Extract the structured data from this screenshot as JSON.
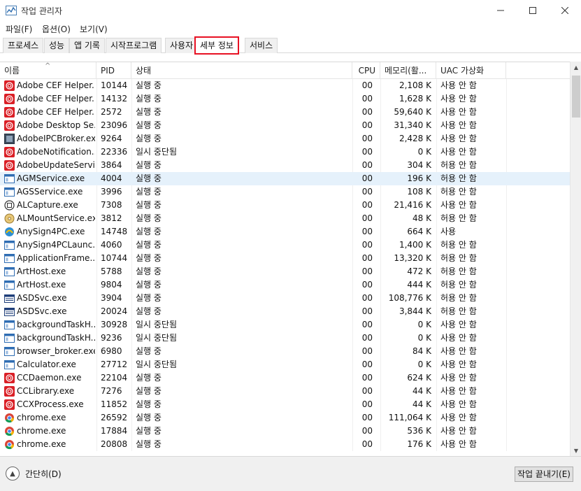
{
  "window": {
    "title": "작업 관리자"
  },
  "menu": [
    "파일(F)",
    "옵션(O)",
    "보기(V)"
  ],
  "tabs": [
    "프로세스",
    "성능",
    "앱 기록",
    "시작프로그램",
    "사용자",
    "세부 정보",
    "서비스"
  ],
  "active_tab": "세부 정보",
  "columns": [
    "이름",
    "PID",
    "상태",
    "CPU",
    "메모리(활...",
    "UAC 가상화"
  ],
  "rows": [
    {
      "icon": "adobe-icon",
      "name": "Adobe CEF Helper....",
      "pid": "10144",
      "status": "실행 중",
      "cpu": "00",
      "mem": "2,108 K",
      "uac": "사용 안 함"
    },
    {
      "icon": "adobe-icon",
      "name": "Adobe CEF Helper....",
      "pid": "14132",
      "status": "실행 중",
      "cpu": "00",
      "mem": "1,628 K",
      "uac": "사용 안 함"
    },
    {
      "icon": "adobe-icon",
      "name": "Adobe CEF Helper....",
      "pid": "2572",
      "status": "실행 중",
      "cpu": "00",
      "mem": "59,640 K",
      "uac": "사용 안 함"
    },
    {
      "icon": "adobe-icon",
      "name": "Adobe Desktop Se...",
      "pid": "23096",
      "status": "실행 중",
      "cpu": "00",
      "mem": "31,340 K",
      "uac": "사용 안 함"
    },
    {
      "icon": "app-dark-icon",
      "name": "AdobeIPCBroker.exe",
      "pid": "9264",
      "status": "실행 중",
      "cpu": "00",
      "mem": "2,428 K",
      "uac": "사용 안 함"
    },
    {
      "icon": "adobe-icon",
      "name": "AdobeNotification....",
      "pid": "22336",
      "status": "일시 중단됨",
      "cpu": "00",
      "mem": "0 K",
      "uac": "사용 안 함"
    },
    {
      "icon": "adobe-icon",
      "name": "AdobeUpdateServi...",
      "pid": "3864",
      "status": "실행 중",
      "cpu": "00",
      "mem": "304 K",
      "uac": "허용 안 함"
    },
    {
      "icon": "window-icon",
      "name": "AGMService.exe",
      "pid": "4004",
      "status": "실행 중",
      "cpu": "00",
      "mem": "196 K",
      "uac": "허용 안 함",
      "selected": true
    },
    {
      "icon": "window-icon",
      "name": "AGSService.exe",
      "pid": "3996",
      "status": "실행 중",
      "cpu": "00",
      "mem": "108 K",
      "uac": "허용 안 함"
    },
    {
      "icon": "capture-icon",
      "name": "ALCapture.exe",
      "pid": "7308",
      "status": "실행 중",
      "cpu": "00",
      "mem": "21,416 K",
      "uac": "사용 안 함"
    },
    {
      "icon": "disc-icon",
      "name": "ALMountService.exe",
      "pid": "3812",
      "status": "실행 중",
      "cpu": "00",
      "mem": "48 K",
      "uac": "허용 안 함"
    },
    {
      "icon": "anysign-icon",
      "name": "AnySign4PC.exe",
      "pid": "14748",
      "status": "실행 중",
      "cpu": "00",
      "mem": "664 K",
      "uac": "사용"
    },
    {
      "icon": "window-icon",
      "name": "AnySign4PCLaunc...",
      "pid": "4060",
      "status": "실행 중",
      "cpu": "00",
      "mem": "1,400 K",
      "uac": "허용 안 함"
    },
    {
      "icon": "window-icon",
      "name": "ApplicationFrame...",
      "pid": "10744",
      "status": "실행 중",
      "cpu": "00",
      "mem": "13,320 K",
      "uac": "허용 안 함"
    },
    {
      "icon": "window-icon",
      "name": "ArtHost.exe",
      "pid": "5788",
      "status": "실행 중",
      "cpu": "00",
      "mem": "472 K",
      "uac": "허용 안 함"
    },
    {
      "icon": "window-icon",
      "name": "ArtHost.exe",
      "pid": "9804",
      "status": "실행 중",
      "cpu": "00",
      "mem": "444 K",
      "uac": "허용 안 함"
    },
    {
      "icon": "asd-icon",
      "name": "ASDSvc.exe",
      "pid": "3904",
      "status": "실행 중",
      "cpu": "00",
      "mem": "108,776 K",
      "uac": "허용 안 함"
    },
    {
      "icon": "asd-icon",
      "name": "ASDSvc.exe",
      "pid": "20024",
      "status": "실행 중",
      "cpu": "00",
      "mem": "3,844 K",
      "uac": "허용 안 함"
    },
    {
      "icon": "window-icon",
      "name": "backgroundTaskH...",
      "pid": "30928",
      "status": "일시 중단됨",
      "cpu": "00",
      "mem": "0 K",
      "uac": "사용 안 함"
    },
    {
      "icon": "window-icon",
      "name": "backgroundTaskH...",
      "pid": "9236",
      "status": "일시 중단됨",
      "cpu": "00",
      "mem": "0 K",
      "uac": "사용 안 함"
    },
    {
      "icon": "window-icon",
      "name": "browser_broker.exe",
      "pid": "6980",
      "status": "실행 중",
      "cpu": "00",
      "mem": "84 K",
      "uac": "사용 안 함"
    },
    {
      "icon": "window-icon",
      "name": "Calculator.exe",
      "pid": "27712",
      "status": "일시 중단됨",
      "cpu": "00",
      "mem": "0 K",
      "uac": "사용 안 함"
    },
    {
      "icon": "adobe-icon",
      "name": "CCDaemon.exe",
      "pid": "22104",
      "status": "실행 중",
      "cpu": "00",
      "mem": "624 K",
      "uac": "사용 안 함"
    },
    {
      "icon": "adobe-icon",
      "name": "CCLibrary.exe",
      "pid": "7276",
      "status": "실행 중",
      "cpu": "00",
      "mem": "44 K",
      "uac": "사용 안 함"
    },
    {
      "icon": "adobe-icon",
      "name": "CCXProcess.exe",
      "pid": "11852",
      "status": "실행 중",
      "cpu": "00",
      "mem": "44 K",
      "uac": "사용 안 함"
    },
    {
      "icon": "chrome-icon",
      "name": "chrome.exe",
      "pid": "26592",
      "status": "실행 중",
      "cpu": "00",
      "mem": "111,064 K",
      "uac": "사용 안 함"
    },
    {
      "icon": "chrome-icon",
      "name": "chrome.exe",
      "pid": "17884",
      "status": "실행 중",
      "cpu": "00",
      "mem": "536 K",
      "uac": "사용 안 함"
    },
    {
      "icon": "chrome-icon",
      "name": "chrome.exe",
      "pid": "20808",
      "status": "실행 중",
      "cpu": "00",
      "mem": "176 K",
      "uac": "사용 안 함"
    }
  ],
  "footer": {
    "collapse_label": "간단히(D)",
    "end_task_label": "작업 끝내기(E)"
  },
  "colors": {
    "selected_row": "#e5f1fb",
    "active_tab_border": "#e81123",
    "adobe_red": "#da1f26"
  }
}
